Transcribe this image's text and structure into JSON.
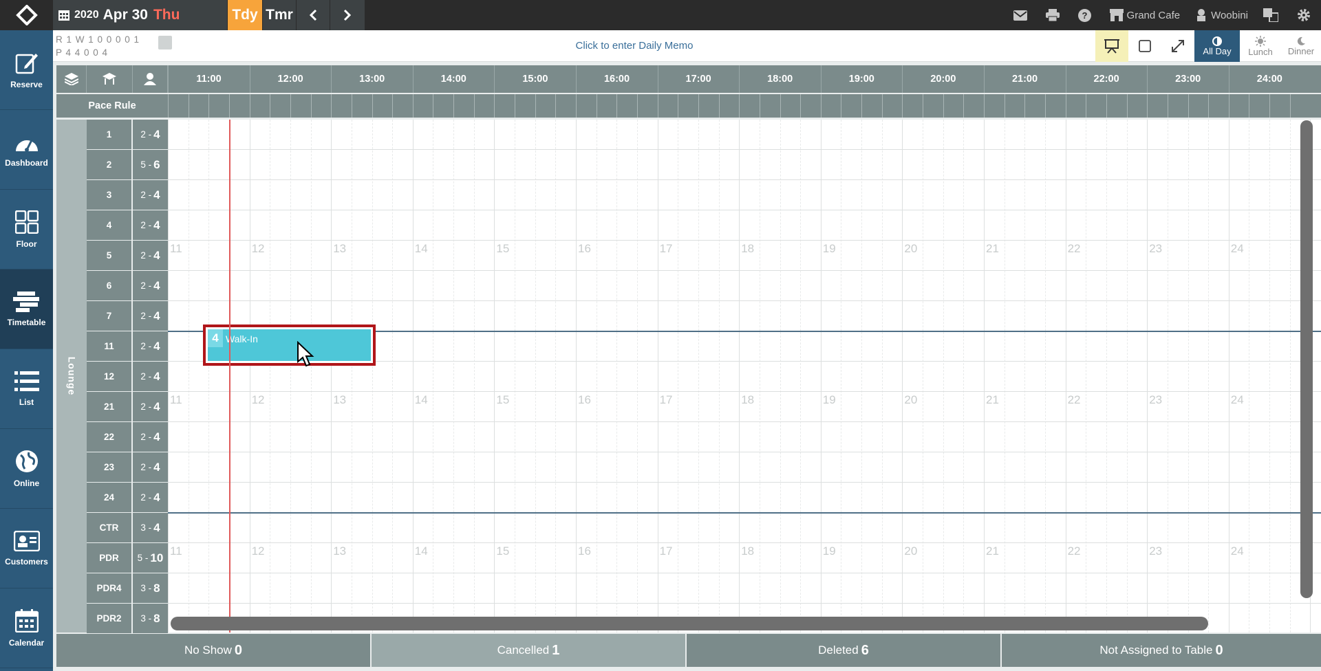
{
  "topbar": {
    "year": "2020",
    "month_day": "Apr 30",
    "weekday": "Thu",
    "today_label": "Tdy",
    "tomorrow_label": "Tmr",
    "restaurant": "Grand Cafe",
    "user": "Woobini"
  },
  "sidebar": {
    "items": [
      {
        "label": "Reserve",
        "icon": "edit-icon"
      },
      {
        "label": "Dashboard",
        "icon": "gauge-icon"
      },
      {
        "label": "Floor",
        "icon": "grid-icon"
      },
      {
        "label": "Timetable",
        "icon": "timetable-icon",
        "active": true
      },
      {
        "label": "List",
        "icon": "list-icon"
      },
      {
        "label": "Online",
        "icon": "globe-icon"
      },
      {
        "label": "Customers",
        "icon": "id-card-icon"
      },
      {
        "label": "Calendar",
        "icon": "calendar-icon"
      }
    ]
  },
  "toolbar": {
    "counts_row1": "R 1 W 1 0 0 0 0 1",
    "counts_row2": "P 4  4  0  0  4",
    "memo_placeholder": "Click to enter Daily Memo",
    "all_day": "All Day",
    "lunch": "Lunch",
    "dinner": "Dinner"
  },
  "timetable": {
    "hours": [
      "11:00",
      "12:00",
      "13:00",
      "14:00",
      "15:00",
      "16:00",
      "17:00",
      "18:00",
      "19:00",
      "20:00",
      "21:00",
      "22:00",
      "23:00",
      "24:00"
    ],
    "pace_rule_label": "Pace Rule",
    "zone": "Lounge",
    "hour_markers": [
      "11",
      "12",
      "13",
      "14",
      "15",
      "16",
      "17",
      "18",
      "19",
      "20",
      "21",
      "22",
      "23",
      "24"
    ],
    "tables": [
      {
        "name": "1",
        "min": "2",
        "max": "4"
      },
      {
        "name": "2",
        "min": "5",
        "max": "6"
      },
      {
        "name": "3",
        "min": "2",
        "max": "4"
      },
      {
        "name": "4",
        "min": "2",
        "max": "4"
      },
      {
        "name": "5",
        "min": "2",
        "max": "4"
      },
      {
        "name": "6",
        "min": "2",
        "max": "4"
      },
      {
        "name": "7",
        "min": "2",
        "max": "4"
      },
      {
        "name": "11",
        "min": "2",
        "max": "4"
      },
      {
        "name": "12",
        "min": "2",
        "max": "4"
      },
      {
        "name": "21",
        "min": "2",
        "max": "4"
      },
      {
        "name": "22",
        "min": "2",
        "max": "4"
      },
      {
        "name": "23",
        "min": "2",
        "max": "4"
      },
      {
        "name": "24",
        "min": "2",
        "max": "4"
      },
      {
        "name": "CTR",
        "min": "3",
        "max": "4"
      },
      {
        "name": "PDR",
        "min": "5",
        "max": "10"
      },
      {
        "name": "PDR4",
        "min": "3",
        "max": "8"
      },
      {
        "name": "PDR2",
        "min": "3",
        "max": "8"
      }
    ],
    "booking": {
      "party": "4",
      "label": "Walk-In",
      "table": "11",
      "start_hour": 11.75,
      "end_hour": 13.75
    },
    "current_time_hour": 11.75
  },
  "footer": {
    "no_show_label": "No Show",
    "no_show_count": "0",
    "cancelled_label": "Cancelled",
    "cancelled_count": "1",
    "deleted_label": "Deleted",
    "deleted_count": "6",
    "not_assigned_label": "Not Assigned to Table",
    "not_assigned_count": "0"
  },
  "colors": {
    "accent": "#f7a43b",
    "sidebar": "#2d5a7b",
    "header_gray": "#7b8b8b",
    "booking": "#4ec7d8",
    "selection": "#b0161a",
    "now_line": "#e05a5a"
  }
}
